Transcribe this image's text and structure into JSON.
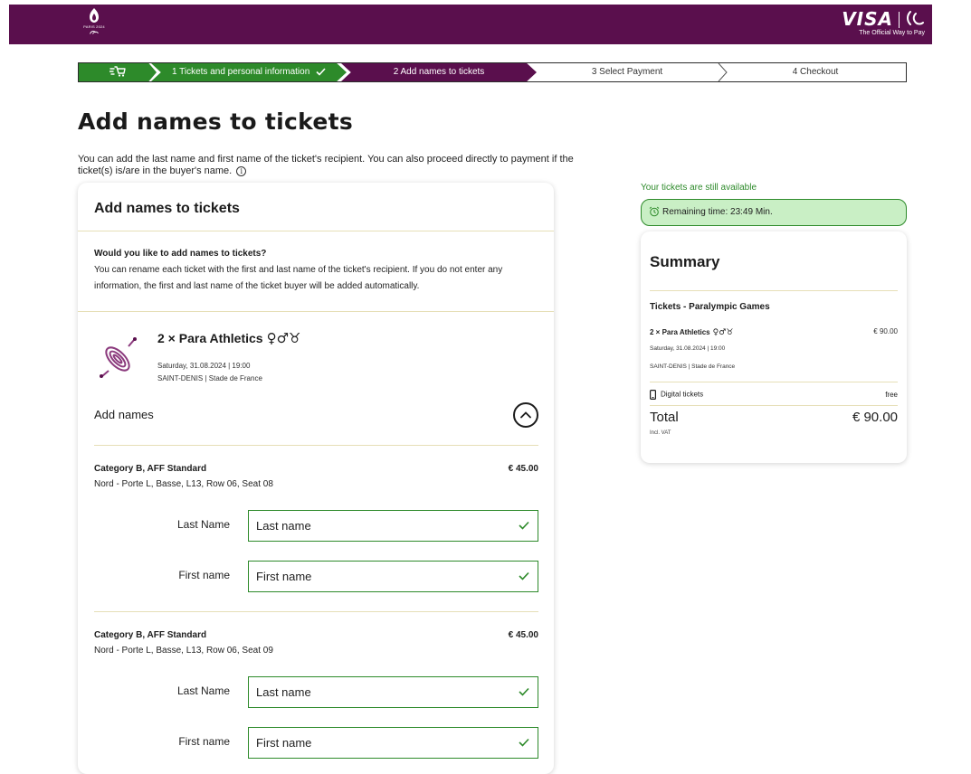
{
  "header": {
    "logo_text": "PARIS 2024",
    "visa_word": "VISA",
    "visa_tagline": "The Official Way to Pay",
    "bg_color": "#5a0f4d"
  },
  "stepper": {
    "cart_icon": "cart-icon",
    "steps": [
      {
        "label": "1  Tickets and personal information",
        "state": "done"
      },
      {
        "label": "2  Add names to tickets",
        "state": "active"
      },
      {
        "label": "3  Select Payment",
        "state": "todo"
      },
      {
        "label": "4  Checkout",
        "state": "todo"
      }
    ],
    "done_color": "#2d8a2a",
    "active_color": "#5a0f4d"
  },
  "page": {
    "title": "Add names to tickets",
    "intro": "You can add the last name and first name of the ticket's recipient. You can also proceed directly to payment if the ticket(s) is/are in the buyer's name.",
    "info_glyph": "i"
  },
  "card": {
    "title": "Add names to tickets",
    "question_title": "Would you like to add names to tickets?",
    "question_text": "You can rename each ticket with the first and last name of the ticket's recipient. If you do not enter any information, the first and last name of the ticket buyer will be added automatically.",
    "event": {
      "title": "2 × Para Athletics",
      "symbols": "♀♂♉",
      "date": "Saturday, 31.08.2024 | 19:00",
      "venue": "SAINT-DENIS | Stade de France"
    },
    "add_names_label": "Add names",
    "tickets": [
      {
        "category": "Category B, AFF Standard",
        "price": "€ 45.00",
        "location": "Nord - Porte L, Basse, L13, Row 06, Seat 08",
        "last_name_label": "Last Name",
        "last_name_placeholder": "Last name",
        "first_name_label": "First name",
        "first_name_placeholder": "First name"
      },
      {
        "category": "Category B, AFF Standard",
        "price": "€ 45.00",
        "location": "Nord - Porte L, Basse, L13, Row 06, Seat 09",
        "last_name_label": "Last Name",
        "last_name_placeholder": "Last name",
        "first_name_label": "First name",
        "first_name_placeholder": "First name"
      }
    ]
  },
  "sidebar": {
    "availability": "Your tickets are still available",
    "remaining": "Remaining time: 23:49 Min.",
    "summary": {
      "title": "Summary",
      "category": "Tickets - Paralympic Games",
      "event": "2 × Para Athletics",
      "symbols": "♀♂♉",
      "price": "€ 90.00",
      "date": "Saturday, 31.08.2024 | 19:00",
      "venue": "SAINT-DENIS | Stade de France",
      "digital": "Digital tickets",
      "digital_price": "free",
      "total_label": "Total",
      "total_amount": "€ 90.00",
      "vat": "Incl. VAT"
    },
    "success_color": "#2d8a2a",
    "timer_bg": "#c9efc5"
  }
}
